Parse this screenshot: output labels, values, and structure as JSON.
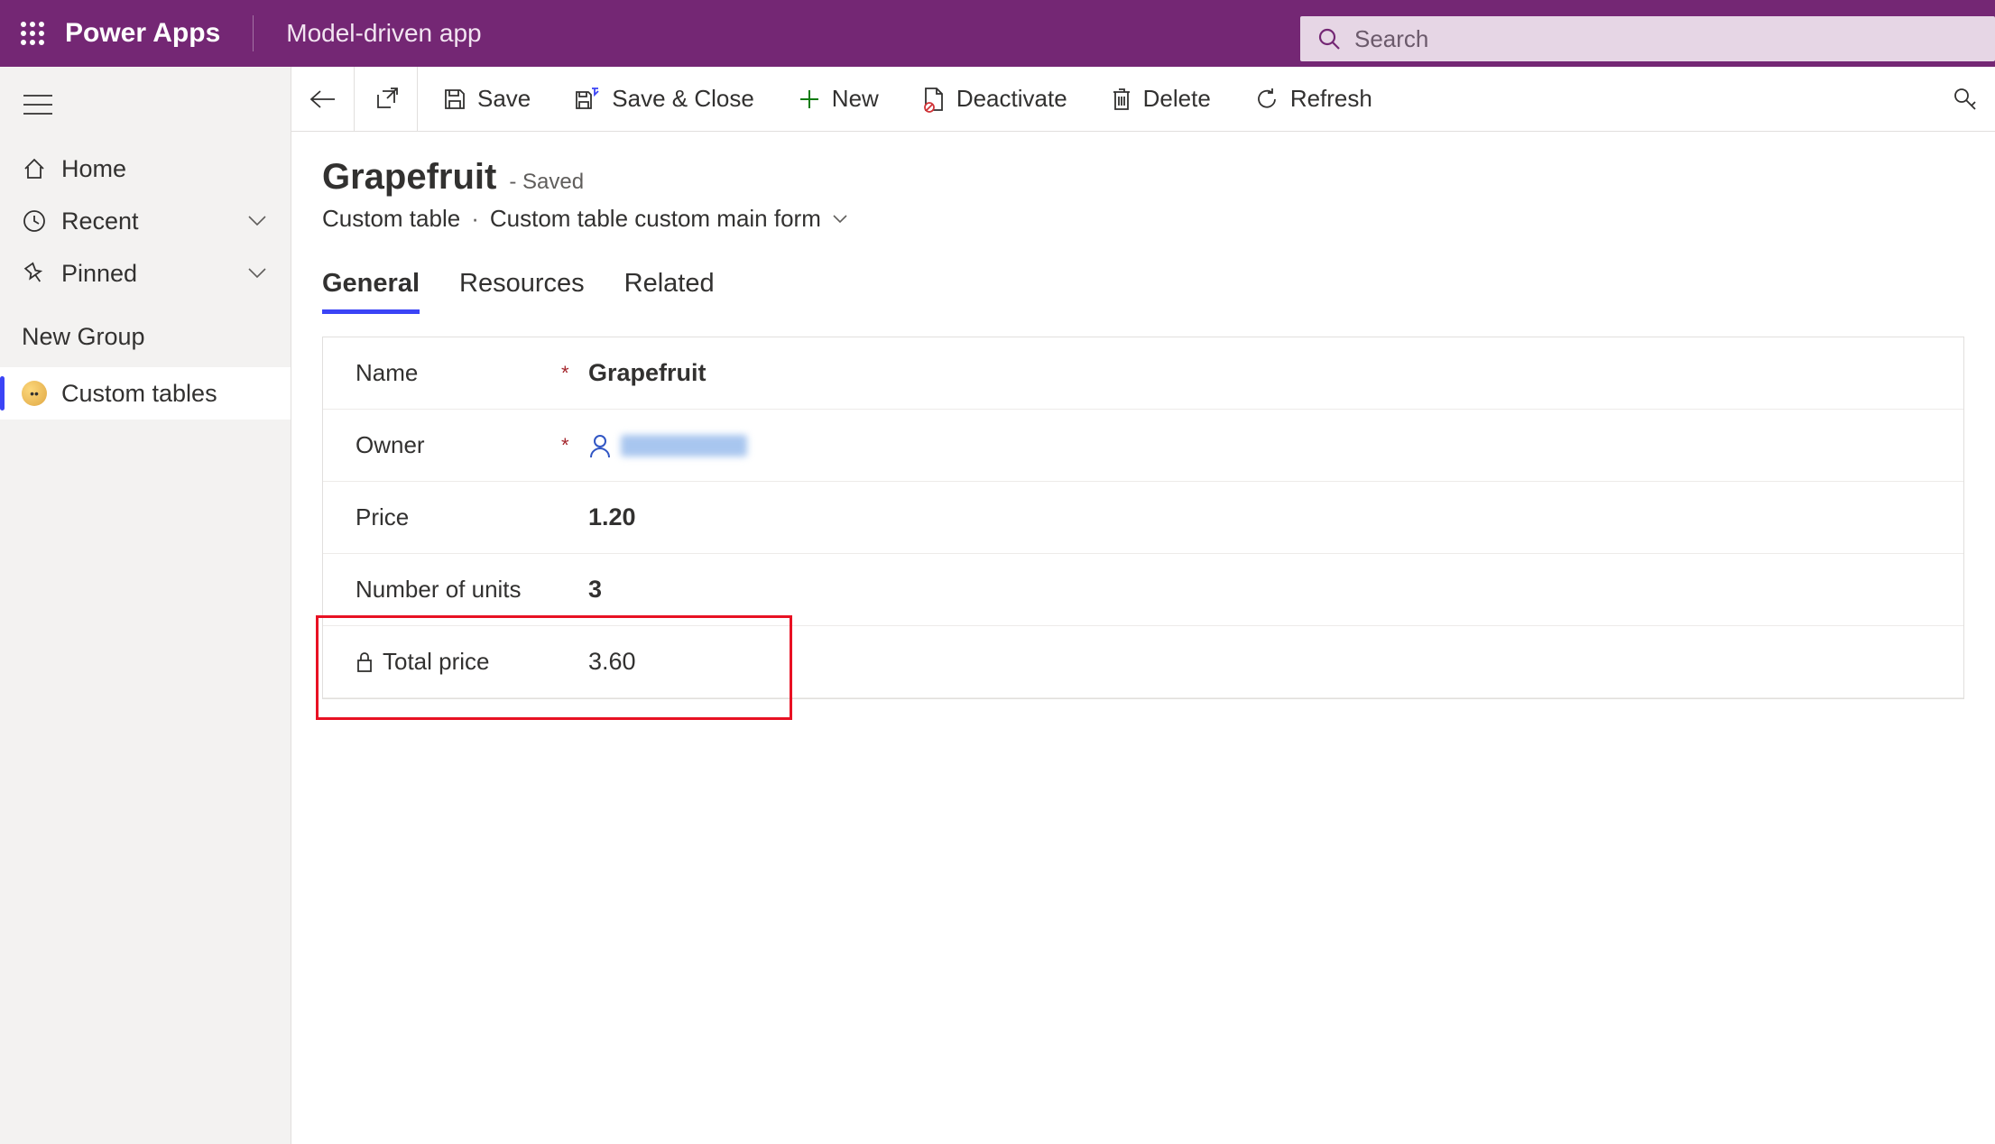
{
  "header": {
    "brand": "Power Apps",
    "app_name": "Model-driven app",
    "search_placeholder": "Search"
  },
  "sidebar": {
    "home": "Home",
    "recent": "Recent",
    "pinned": "Pinned",
    "group_label": "New Group",
    "custom_tables": "Custom tables"
  },
  "commands": {
    "save": "Save",
    "save_close": "Save & Close",
    "new": "New",
    "deactivate": "Deactivate",
    "delete": "Delete",
    "refresh": "Refresh"
  },
  "record": {
    "title": "Grapefruit",
    "status": "- Saved",
    "entity": "Custom table",
    "form_name": "Custom table custom main form"
  },
  "tabs": {
    "general": "General",
    "resources": "Resources",
    "related": "Related"
  },
  "form": {
    "name_label": "Name",
    "name_value": "Grapefruit",
    "owner_label": "Owner",
    "price_label": "Price",
    "price_value": "1.20",
    "units_label": "Number of units",
    "units_value": "3",
    "total_label": "Total price",
    "total_value": "3.60"
  }
}
